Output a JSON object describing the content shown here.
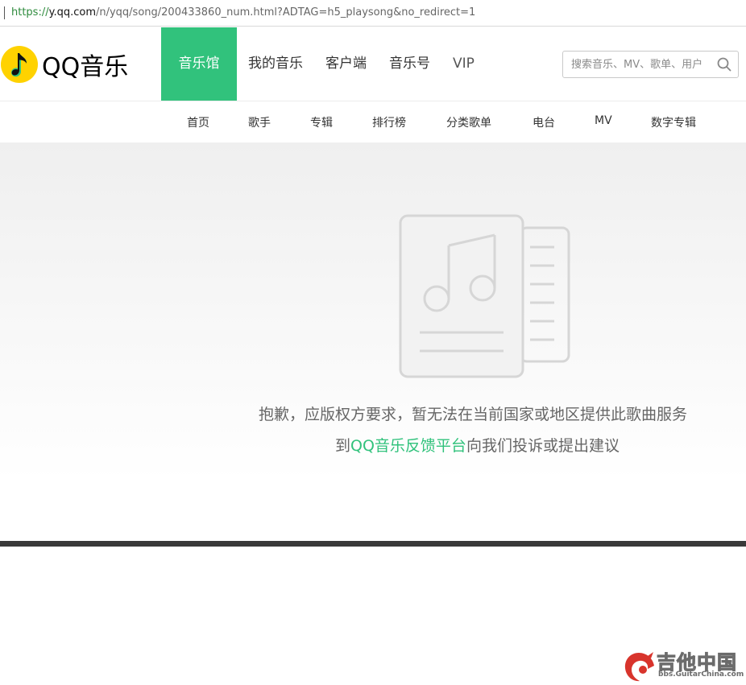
{
  "browser": {
    "url_scheme": "https://",
    "url_host": "y.qq.com",
    "url_rest": "/n/yqq/song/200433860_num.html?ADTAG=h5_playsong&no_redirect=1"
  },
  "brand": {
    "name": "QQ音乐",
    "accent_color": "#31c27c"
  },
  "nav": {
    "items": [
      {
        "label": "音乐馆",
        "active": true
      },
      {
        "label": "我的音乐"
      },
      {
        "label": "客户端"
      },
      {
        "label": "音乐号"
      },
      {
        "label": "VIP"
      }
    ]
  },
  "search": {
    "placeholder": "搜索音乐、MV、歌单、用户",
    "icon": "search-icon"
  },
  "subnav": {
    "items": [
      "首页",
      "歌手",
      "专辑",
      "排行榜",
      "分类歌单",
      "电台",
      "MV",
      "数字专辑"
    ]
  },
  "message": {
    "line1": "抱歉，应版权方要求，暂无法在当前国家或地区提供此歌曲服务",
    "line2_prefix": "到",
    "line2_link": "QQ音乐反馈平台",
    "line2_suffix": "向我们投诉或提出建议",
    "illustration_icon": "music-document-icon"
  },
  "watermark": {
    "text_cn": "吉他中国",
    "text_url": "bbs.GuitarChina.com"
  }
}
